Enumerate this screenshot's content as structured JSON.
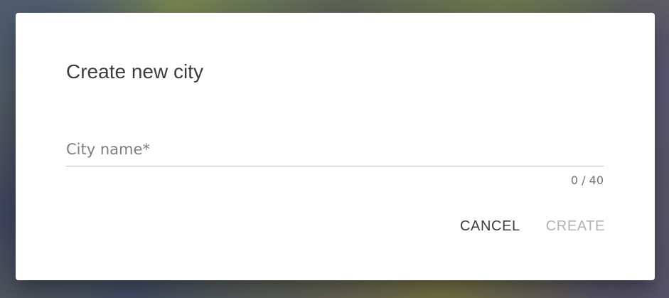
{
  "dialog": {
    "title": "Create new city",
    "field": {
      "label": "City name*",
      "value": "",
      "counter": "0 / 40"
    },
    "actions": {
      "cancel_label": "CANCEL",
      "create_label": "CREATE"
    }
  },
  "colors": {
    "dialog_background": "#ffffff",
    "primary_text": "#3c3c3c",
    "disabled_text": "#b3b3b3",
    "label_text": "#7e7e7e",
    "underline": "#b8b8b8"
  }
}
